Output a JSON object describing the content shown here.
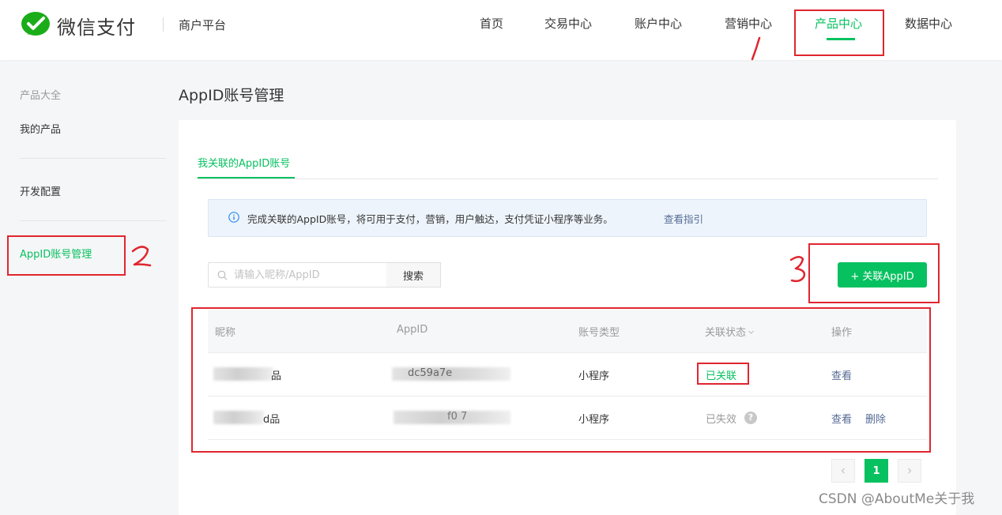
{
  "header": {
    "brand": "微信支付",
    "platform": "商户平台",
    "nav": [
      "首页",
      "交易中心",
      "账户中心",
      "营销中心",
      "产品中心",
      "数据中心"
    ],
    "active_nav": "产品中心"
  },
  "sidebar": {
    "category": "产品大全",
    "items": [
      "我的产品",
      "开发配置",
      "AppID账号管理"
    ],
    "active_item": "AppID账号管理"
  },
  "page": {
    "title": "AppID账号管理",
    "tab": "我关联的AppID账号"
  },
  "info": {
    "text": "完成关联的AppID账号，将可用于支付，营销，用户触达，支付凭证小程序等业务。",
    "link": "查看指引"
  },
  "search": {
    "placeholder": "请输入昵称/AppID",
    "button": "搜索"
  },
  "add_button": "+ 关联AppID",
  "table": {
    "columns": [
      "昵称",
      "AppID",
      "账号类型",
      "关联状态",
      "操作"
    ],
    "rows": [
      {
        "name_visible": "品",
        "appid_visible": "dc59a7e",
        "type": "小程序",
        "status": "已关联",
        "actions": [
          "查看"
        ]
      },
      {
        "name_visible": "d品",
        "appid_visible": "f0 7",
        "type": "小程序",
        "status": "已失效",
        "actions": [
          "查看",
          "删除"
        ]
      }
    ]
  },
  "pagination": {
    "current": "1"
  },
  "annotations": [
    "1",
    "2",
    "3"
  ],
  "watermark": "CSDN @AboutMe关于我",
  "colors": {
    "accent": "#07c160",
    "link": "#576b95",
    "annotation": "#e0262f"
  },
  "icons": [
    "wechat-pay-logo-icon",
    "info-icon",
    "search-icon",
    "question-icon",
    "chevron-left-icon",
    "chevron-right-icon",
    "sort-chevron-icon"
  ]
}
